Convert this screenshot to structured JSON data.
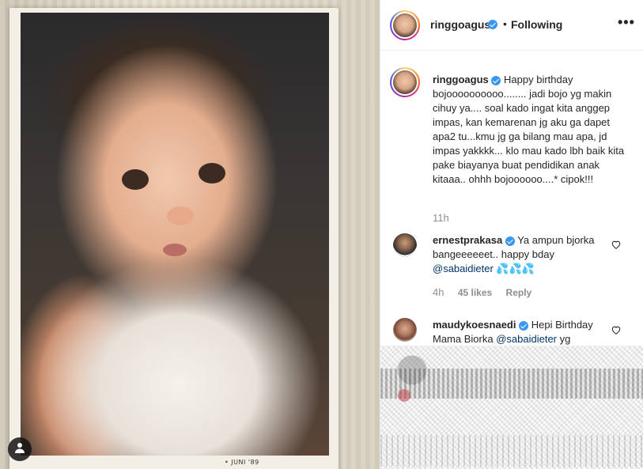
{
  "post": {
    "photo_caption": "• JUNI '89"
  },
  "header": {
    "username": "ringgoagus",
    "dot": "•",
    "follow_status": "Following",
    "more_label": "•••"
  },
  "caption": {
    "username": "ringgoagus",
    "text": "Happy birthday bojoooooooooo........ jadi bojo yg makin cihuy ya.... soal kado ingat kita anggep impas, kan kemarenan jg aku ga dapet apa2 tu...kmu jg ga bilang mau apa, jd impas yakkkk... klo mau kado lbh baik kita pake biayanya buat pendidikan anak kitaaa.. ohhh bojoooooo....* cipok!!!",
    "time": "11h"
  },
  "comments": [
    {
      "username": "ernestprakasa",
      "text": "Ya ampun bjorka bangeeeeeet.. happy bday",
      "mention": "@sabaidieter",
      "emoji": "💦💦💦",
      "time": "4h",
      "likes": "45 likes",
      "reply": "Reply"
    },
    {
      "username": "maudykoesnaedi",
      "text": "Hepi Birthday Mama Biorka",
      "mention": "@sabaidieter",
      "trailing": "yg"
    }
  ],
  "colors": {
    "verified": "#3897f0",
    "text": "#262626",
    "muted": "#8e8e8e",
    "mention": "#003569"
  },
  "icons": {
    "user_tag": "user-tag-icon",
    "verified": "verified-badge-icon",
    "heart": "heart-icon",
    "more": "more-options-icon"
  }
}
